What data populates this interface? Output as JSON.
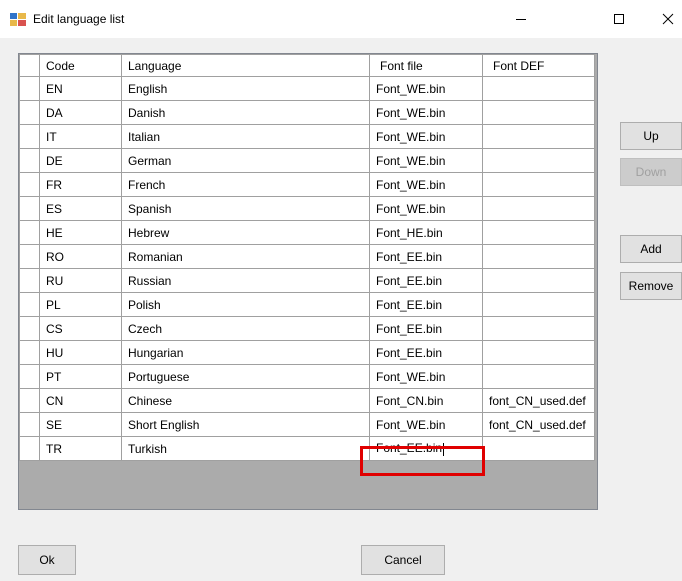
{
  "window": {
    "title": "Edit language list",
    "controls": {
      "minimize": "–",
      "maximize": "□",
      "close": "✕"
    }
  },
  "grid": {
    "columns": [
      "Code",
      "Language",
      "Font file",
      "Font DEF"
    ],
    "rows": [
      {
        "code": "EN",
        "language": "English",
        "font_file": "Font_WE.bin",
        "font_def": ""
      },
      {
        "code": "DA",
        "language": "Danish",
        "font_file": "Font_WE.bin",
        "font_def": ""
      },
      {
        "code": "IT",
        "language": "Italian",
        "font_file": "Font_WE.bin",
        "font_def": ""
      },
      {
        "code": "DE",
        "language": "German",
        "font_file": "Font_WE.bin",
        "font_def": ""
      },
      {
        "code": "FR",
        "language": "French",
        "font_file": "Font_WE.bin",
        "font_def": ""
      },
      {
        "code": "ES",
        "language": "Spanish",
        "font_file": "Font_WE.bin",
        "font_def": ""
      },
      {
        "code": "HE",
        "language": "Hebrew",
        "font_file": "Font_HE.bin",
        "font_def": ""
      },
      {
        "code": "RO",
        "language": "Romanian",
        "font_file": "Font_EE.bin",
        "font_def": ""
      },
      {
        "code": "RU",
        "language": "Russian",
        "font_file": "Font_EE.bin",
        "font_def": ""
      },
      {
        "code": "PL",
        "language": "Polish",
        "font_file": "Font_EE.bin",
        "font_def": ""
      },
      {
        "code": "CS",
        "language": "Czech",
        "font_file": "Font_EE.bin",
        "font_def": ""
      },
      {
        "code": "HU",
        "language": "Hungarian",
        "font_file": "Font_EE.bin",
        "font_def": ""
      },
      {
        "code": "PT",
        "language": "Portuguese",
        "font_file": "Font_WE.bin",
        "font_def": ""
      },
      {
        "code": "CN",
        "language": "Chinese",
        "font_file": "Font_CN.bin",
        "font_def": "font_CN_used.def"
      },
      {
        "code": "SE",
        "language": "Short English",
        "font_file": "Font_WE.bin",
        "font_def": "font_CN_used.def"
      },
      {
        "code": "TR",
        "language": "Turkish",
        "font_file": "Font_EE.bin",
        "font_def": ""
      }
    ]
  },
  "buttons": {
    "up": "Up",
    "down": "Down",
    "add": "Add",
    "remove": "Remove",
    "ok": "Ok",
    "cancel": "Cancel"
  },
  "colors": {
    "highlight": "#e00000",
    "grid_background": "#ababab"
  }
}
